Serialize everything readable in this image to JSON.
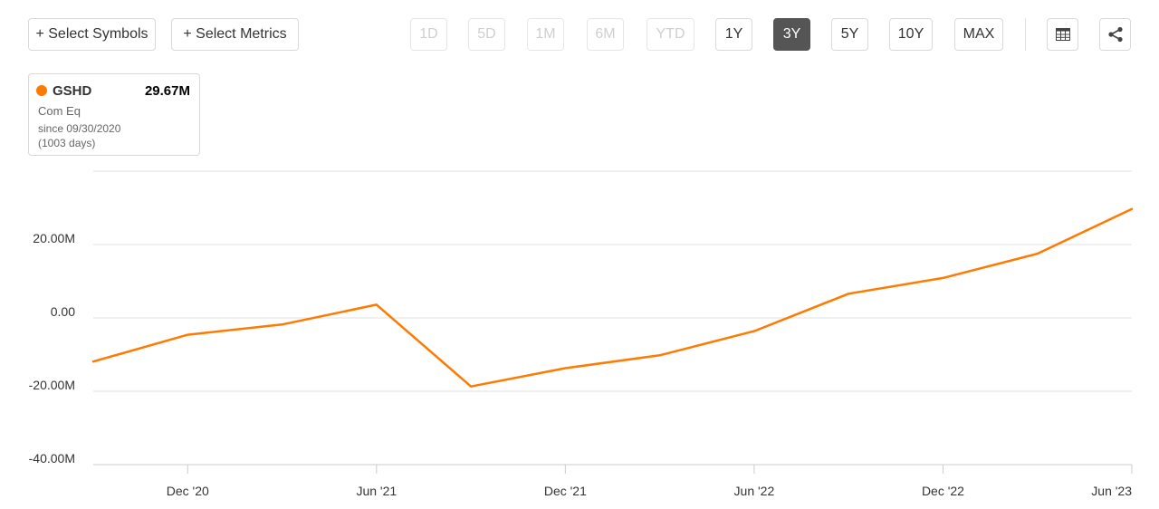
{
  "toolbar": {
    "select_symbols": "+ Select Symbols",
    "select_metrics": "+ Select Metrics",
    "ranges": [
      {
        "label": "1D",
        "state": "disabled"
      },
      {
        "label": "5D",
        "state": "disabled"
      },
      {
        "label": "1M",
        "state": "disabled"
      },
      {
        "label": "6M",
        "state": "disabled"
      },
      {
        "label": "YTD",
        "state": "disabled"
      },
      {
        "label": "1Y",
        "state": "enabled"
      },
      {
        "label": "3Y",
        "state": "active"
      },
      {
        "label": "5Y",
        "state": "enabled"
      },
      {
        "label": "10Y",
        "state": "enabled"
      },
      {
        "label": "MAX",
        "state": "enabled"
      }
    ],
    "table_icon": "table-icon",
    "share_icon": "share-icon"
  },
  "legend": {
    "symbol": "GSHD",
    "value": "29.67M",
    "metric": "Com Eq",
    "since": "since 09/30/2020",
    "days": "(1003 days)",
    "color": "#ff7a00"
  },
  "chart_data": {
    "type": "line",
    "title": "",
    "xlabel": "",
    "ylabel": "",
    "series": [
      {
        "color": "#ff7a00",
        "x": [
          "2020-09-30",
          "2020-12-31",
          "2021-03-31",
          "2021-06-30",
          "2021-09-30",
          "2021-12-31",
          "2022-03-31",
          "2022-06-30",
          "2022-09-30",
          "2022-12-31",
          "2023-03-31",
          "2023-06-30"
        ],
        "values": [
          -11.9,
          -4.6,
          -1.8,
          3.6,
          -18.7,
          -13.7,
          -10.2,
          -3.6,
          6.6,
          10.9,
          17.5,
          29.67
        ]
      }
    ],
    "x_ticks": [
      "Dec '20",
      "Jun '21",
      "Dec '21",
      "Jun '22",
      "Dec '22",
      "Jun '23"
    ],
    "x_tick_indices": [
      1,
      3,
      5,
      7,
      9,
      11
    ],
    "y_ticks": [
      {
        "value": 20,
        "label": "20.00M"
      },
      {
        "value": 0,
        "label": "0.00"
      },
      {
        "value": -20,
        "label": "-20.00M"
      },
      {
        "value": -40,
        "label": "-40.00M"
      }
    ],
    "ylim": [
      -40,
      40
    ],
    "grid": true,
    "legend_position": "top-left"
  }
}
